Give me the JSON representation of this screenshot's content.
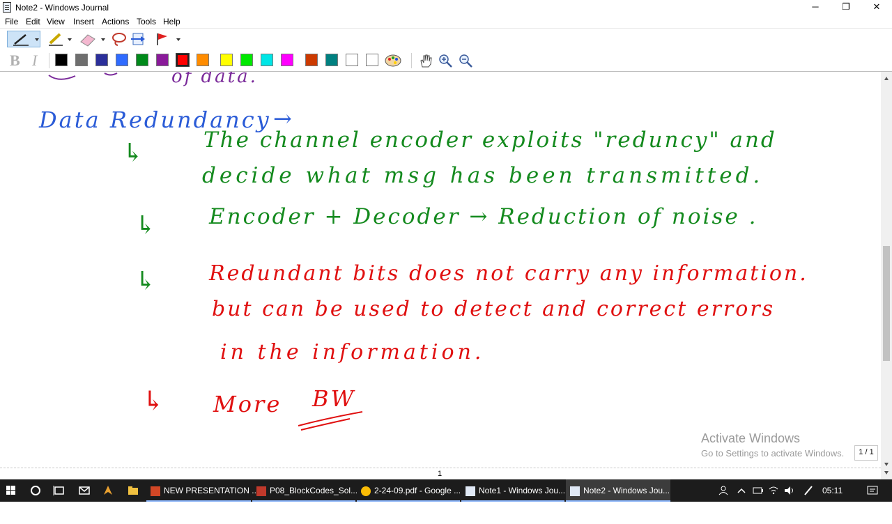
{
  "window": {
    "title": "Note2 - Windows Journal",
    "minimize_glyph": "─",
    "maximize_glyph": "❐",
    "close_glyph": "✕"
  },
  "menu": [
    "File",
    "Edit",
    "View",
    "Insert",
    "Actions",
    "Tools",
    "Help"
  ],
  "toolbar": {
    "format_bold": "B",
    "format_italic": "I",
    "colors": [
      "#000000",
      "#6e6e6e",
      "#2b2f9a",
      "#2f6bff",
      "#008a1a",
      "#8a1a9a",
      "#ff0000",
      "#ff8c00",
      "#ffff00",
      "#00e800",
      "#00e6e6",
      "#ff00ff",
      "#cc3a00",
      "#008080",
      "#ffffff",
      "#ffffff"
    ],
    "selected_color": "#ff0000"
  },
  "note": {
    "top_fragment": "of data.",
    "heading": "Data Redundancy",
    "heading_arrow": "→",
    "bullet_glyph": "↳",
    "line1": "The channel encoder exploits \"reduncy\" and",
    "line2": "decide what msg has been transmitted.",
    "line3": "Encoder + Decoder → Reduction of noise .",
    "line4": "Redundant bits does not carry any information.",
    "line5": "but can be used to detect and correct errors",
    "line6": "in the information.",
    "line7": "More",
    "line7b": "BW",
    "page_number": "1",
    "page_indicator": "1 / 1"
  },
  "watermark": {
    "title": "Activate Windows",
    "subtitle": "Go to Settings to activate Windows."
  },
  "taskbar": {
    "items": [
      {
        "label": "NEW PRESENTATION ...",
        "state": "running"
      },
      {
        "label": "P08_BlockCodes_Sol...",
        "state": "running"
      },
      {
        "label": "2-24-09.pdf - Google ...",
        "state": "running"
      },
      {
        "label": "Note1 - Windows Jou...",
        "state": "running"
      },
      {
        "label": "Note2 - Windows Jou...",
        "state": "active"
      }
    ],
    "clock": "05:11 PM"
  },
  "colors": {
    "ink_blue": "#2a5bd7",
    "ink_green": "#148a1e",
    "ink_red": "#e01010",
    "ink_purple": "#7a2a9a"
  }
}
